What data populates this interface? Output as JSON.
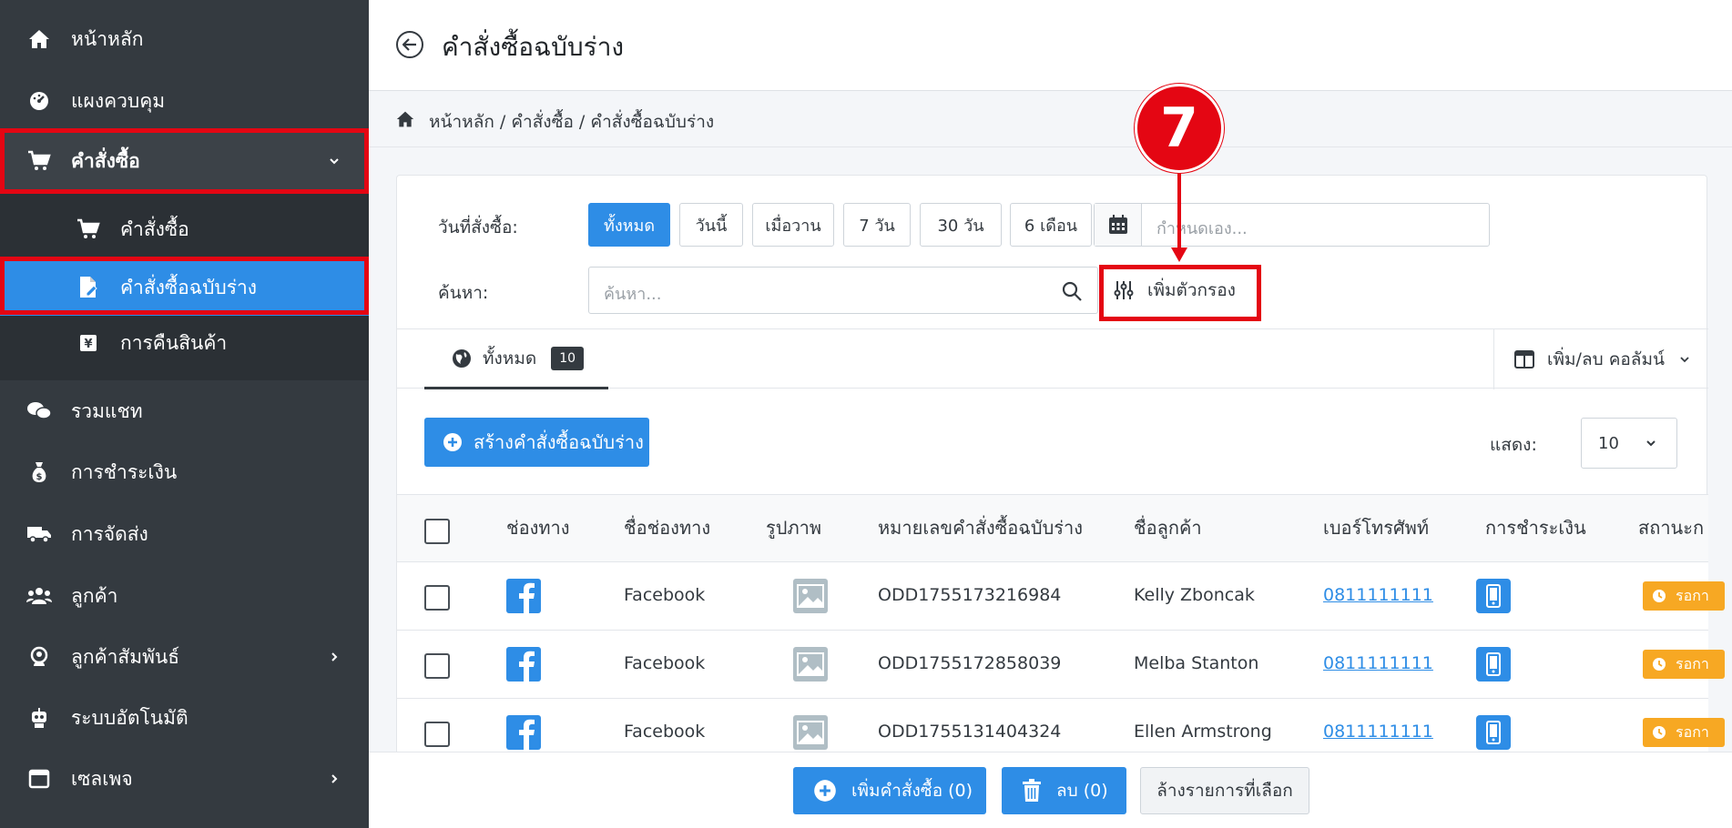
{
  "sidebar": {
    "items": [
      {
        "label": "หน้าหลัก",
        "icon": "home-icon"
      },
      {
        "label": "แผงควบคุม",
        "icon": "dashboard-icon"
      },
      {
        "label": "คำสั่งซื้อ",
        "icon": "cart-icon"
      },
      {
        "label": "รวมแชท",
        "icon": "chat-icon"
      },
      {
        "label": "การชำระเงิน",
        "icon": "money-bag-icon"
      },
      {
        "label": "การจัดส่ง",
        "icon": "truck-icon"
      },
      {
        "label": "ลูกค้า",
        "icon": "users-icon"
      },
      {
        "label": "ลูกค้าสัมพันธ์",
        "icon": "crm-icon"
      },
      {
        "label": "ระบบอัตโนมัติ",
        "icon": "robot-icon"
      },
      {
        "label": "เซลเพจ",
        "icon": "window-icon"
      }
    ],
    "submenu": [
      {
        "label": "คำสั่งซื้อ",
        "icon": "cart-icon"
      },
      {
        "label": "คำสั่งซื้อฉบับร่าง",
        "icon": "draft-file-icon"
      },
      {
        "label": "การคืนสินค้า",
        "icon": "return-icon"
      }
    ]
  },
  "header": {
    "title": "คำสั่งซื้อฉบับร่าง"
  },
  "breadcrumb": "หน้าหลัก / คำสั่งซื้อ / คำสั่งซื้อฉบับร่าง",
  "filters": {
    "date_label": "วันที่สั่งซื้อ:",
    "date_options": [
      "ทั้งหมด",
      "วันนี้",
      "เมื่อวาน",
      "7 วัน",
      "30 วัน",
      "6 เดือน"
    ],
    "custom_placeholder": "กำหนดเอง...",
    "search_label": "ค้นหา:",
    "search_placeholder": "ค้นหา...",
    "add_filter": "เพิ่มตัวกรอง"
  },
  "tabs": {
    "all_label": "ทั้งหมด",
    "all_count": "10",
    "columns_label": "เพิ่ม/ลบ คอลัมน์"
  },
  "toolbar": {
    "create_label": "สร้างคำสั่งซื้อฉบับร่าง",
    "show_label": "แสดง:",
    "show_value": "10"
  },
  "table": {
    "headers": [
      "ช่องทาง",
      "ชื่อช่องทาง",
      "รูปภาพ",
      "หมายเลขคำสั่งซื้อฉบับร่าง",
      "ชื่อลูกค้า",
      "เบอร์โทรศัพท์",
      "การชำระเงิน",
      "สถานะก"
    ],
    "rows": [
      {
        "channel_name": "Facebook",
        "order_no": "ODD1755173216984",
        "customer": "Kelly Zboncak",
        "phone": "0811111111",
        "status": "รอกา"
      },
      {
        "channel_name": "Facebook",
        "order_no": "ODD1755172858039",
        "customer": "Melba Stanton",
        "phone": "0811111111",
        "status": "รอกา"
      },
      {
        "channel_name": "Facebook",
        "order_no": "ODD1755131404324",
        "customer": "Ellen Armstrong",
        "phone": "0811111111",
        "status": "รอกา"
      }
    ]
  },
  "bottom": {
    "add_order": "เพิ่มคำสั่งซื้อ (0)",
    "delete": "ลบ (0)",
    "clear": "ล้างรายการที่เลือก"
  },
  "annotation": {
    "step": "7"
  },
  "colors": {
    "accent": "#2e8de6",
    "sidebar": "#343a40",
    "highlight": "#e40613",
    "warning": "#f7a823"
  }
}
